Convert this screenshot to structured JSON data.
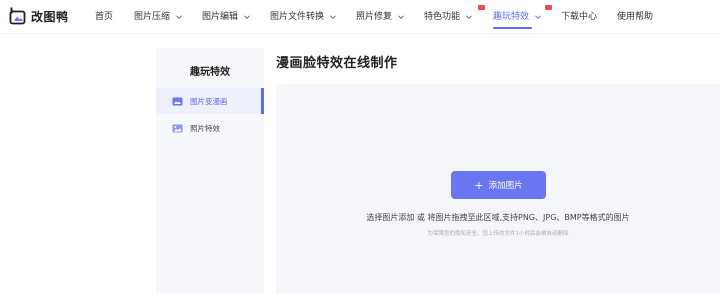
{
  "header": {
    "logo_text": "改图鸭",
    "nav": [
      {
        "label": "首页"
      },
      {
        "label": "图片压缩"
      },
      {
        "label": "图片编辑"
      },
      {
        "label": "图片文件转换"
      },
      {
        "label": "照片修复"
      },
      {
        "label": "特色功能"
      },
      {
        "label": "趣玩特效"
      },
      {
        "label": "下载中心"
      },
      {
        "label": "使用帮助"
      }
    ]
  },
  "sidebar": {
    "title": "趣玩特效",
    "items": [
      {
        "label": "图片变漫画",
        "icon": "image-cartoon-icon",
        "active": true
      },
      {
        "label": "照片特效",
        "icon": "image-effect-icon",
        "active": false
      }
    ]
  },
  "main": {
    "title": "漫画脸特效在线制作",
    "add_button_label": "添加图片",
    "drop_hint": "选择图片添加 或 将图片拖拽至此区域,支持PNG、JPG、BMP等格式的图片",
    "privacy_note": "为保障您的隐私安全，您上传的文件1小时后会被自动删除"
  },
  "colors": {
    "accent": "#5b6cf6",
    "button": "#6a75f2",
    "hot_badge": "#f04b4b",
    "panel_bg": "#f5f6f9"
  }
}
